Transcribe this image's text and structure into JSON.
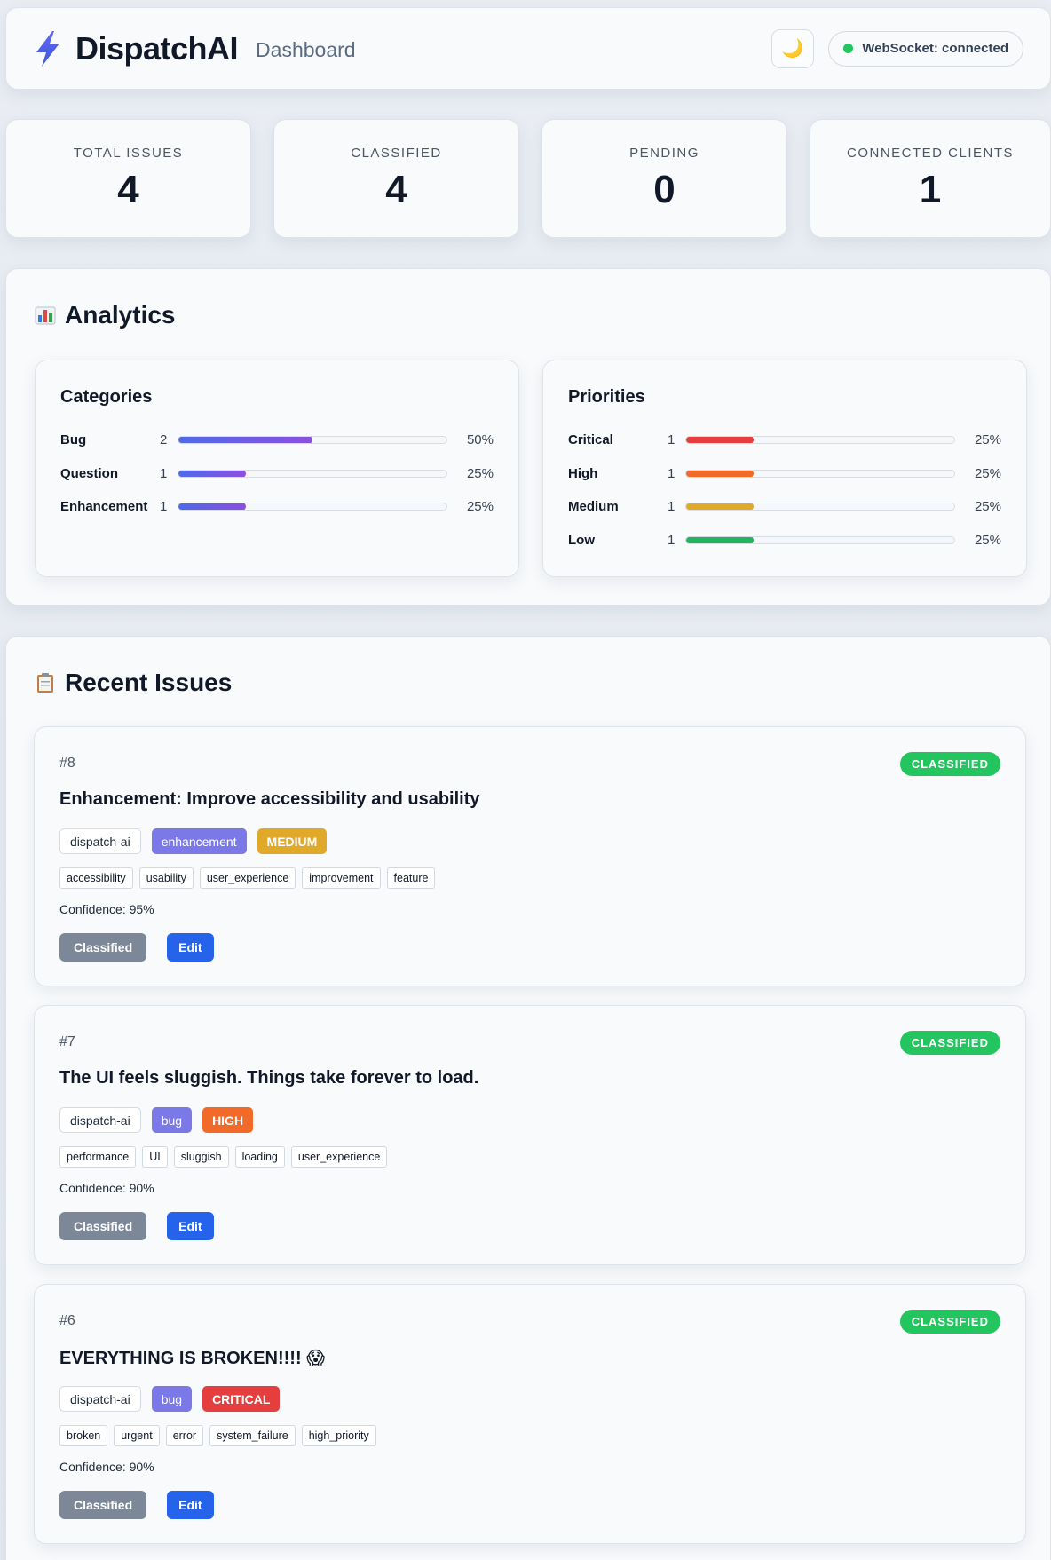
{
  "header": {
    "app_name": "DispatchAI",
    "page_name": "Dashboard",
    "theme_icon": "moon-icon",
    "ws_status": "WebSocket: connected",
    "ws_color": "#22c55e"
  },
  "stats": [
    {
      "label": "TOTAL ISSUES",
      "value": "4"
    },
    {
      "label": "CLASSIFIED",
      "value": "4"
    },
    {
      "label": "PENDING",
      "value": "0"
    },
    {
      "label": "CONNECTED CLIENTS",
      "value": "1"
    }
  ],
  "analytics": {
    "title": "Analytics",
    "categories": {
      "title": "Categories",
      "rows": [
        {
          "label": "Bug",
          "count": "2",
          "pct": "50%",
          "fraction": 0.5
        },
        {
          "label": "Question",
          "count": "1",
          "pct": "25%",
          "fraction": 0.25
        },
        {
          "label": "Enhancement",
          "count": "1",
          "pct": "25%",
          "fraction": 0.25
        }
      ]
    },
    "priorities": {
      "title": "Priorities",
      "rows": [
        {
          "label": "Critical",
          "count": "1",
          "pct": "25%",
          "fraction": 0.25,
          "color": "#e53e3e"
        },
        {
          "label": "High",
          "count": "1",
          "pct": "25%",
          "fraction": 0.25,
          "color": "#f26a2a"
        },
        {
          "label": "Medium",
          "count": "1",
          "pct": "25%",
          "fraction": 0.25,
          "color": "#e0a92a"
        },
        {
          "label": "Low",
          "count": "1",
          "pct": "25%",
          "fraction": 0.25,
          "color": "#22b55e"
        }
      ]
    }
  },
  "recent": {
    "title": "Recent Issues",
    "issues": [
      {
        "number": "#8",
        "status": "CLASSIFIED",
        "title": "Enhancement: Improve accessibility and usability",
        "repo": "dispatch-ai",
        "category": "enhancement",
        "priority": "MEDIUM",
        "priority_color": "#e0a92a",
        "tags": [
          "accessibility",
          "usability",
          "user_experience",
          "improvement",
          "feature"
        ],
        "confidence": "Confidence: 95%",
        "classified_label": "Classified",
        "edit_label": "Edit"
      },
      {
        "number": "#7",
        "status": "CLASSIFIED",
        "title": "The UI feels sluggish. Things take forever to load.",
        "repo": "dispatch-ai",
        "category": "bug",
        "priority": "HIGH",
        "priority_color": "#f26a2a",
        "tags": [
          "performance",
          "UI",
          "sluggish",
          "loading",
          "user_experience"
        ],
        "confidence": "Confidence: 90%",
        "classified_label": "Classified",
        "edit_label": "Edit"
      },
      {
        "number": "#6",
        "status": "CLASSIFIED",
        "title": "EVERYTHING IS BROKEN!!!! 😱",
        "repo": "dispatch-ai",
        "category": "bug",
        "priority": "CRITICAL",
        "priority_color": "#e53e3e",
        "tags": [
          "broken",
          "urgent",
          "error",
          "system_failure",
          "high_priority"
        ],
        "confidence": "Confidence: 90%",
        "classified_label": "Classified",
        "edit_label": "Edit"
      }
    ]
  }
}
